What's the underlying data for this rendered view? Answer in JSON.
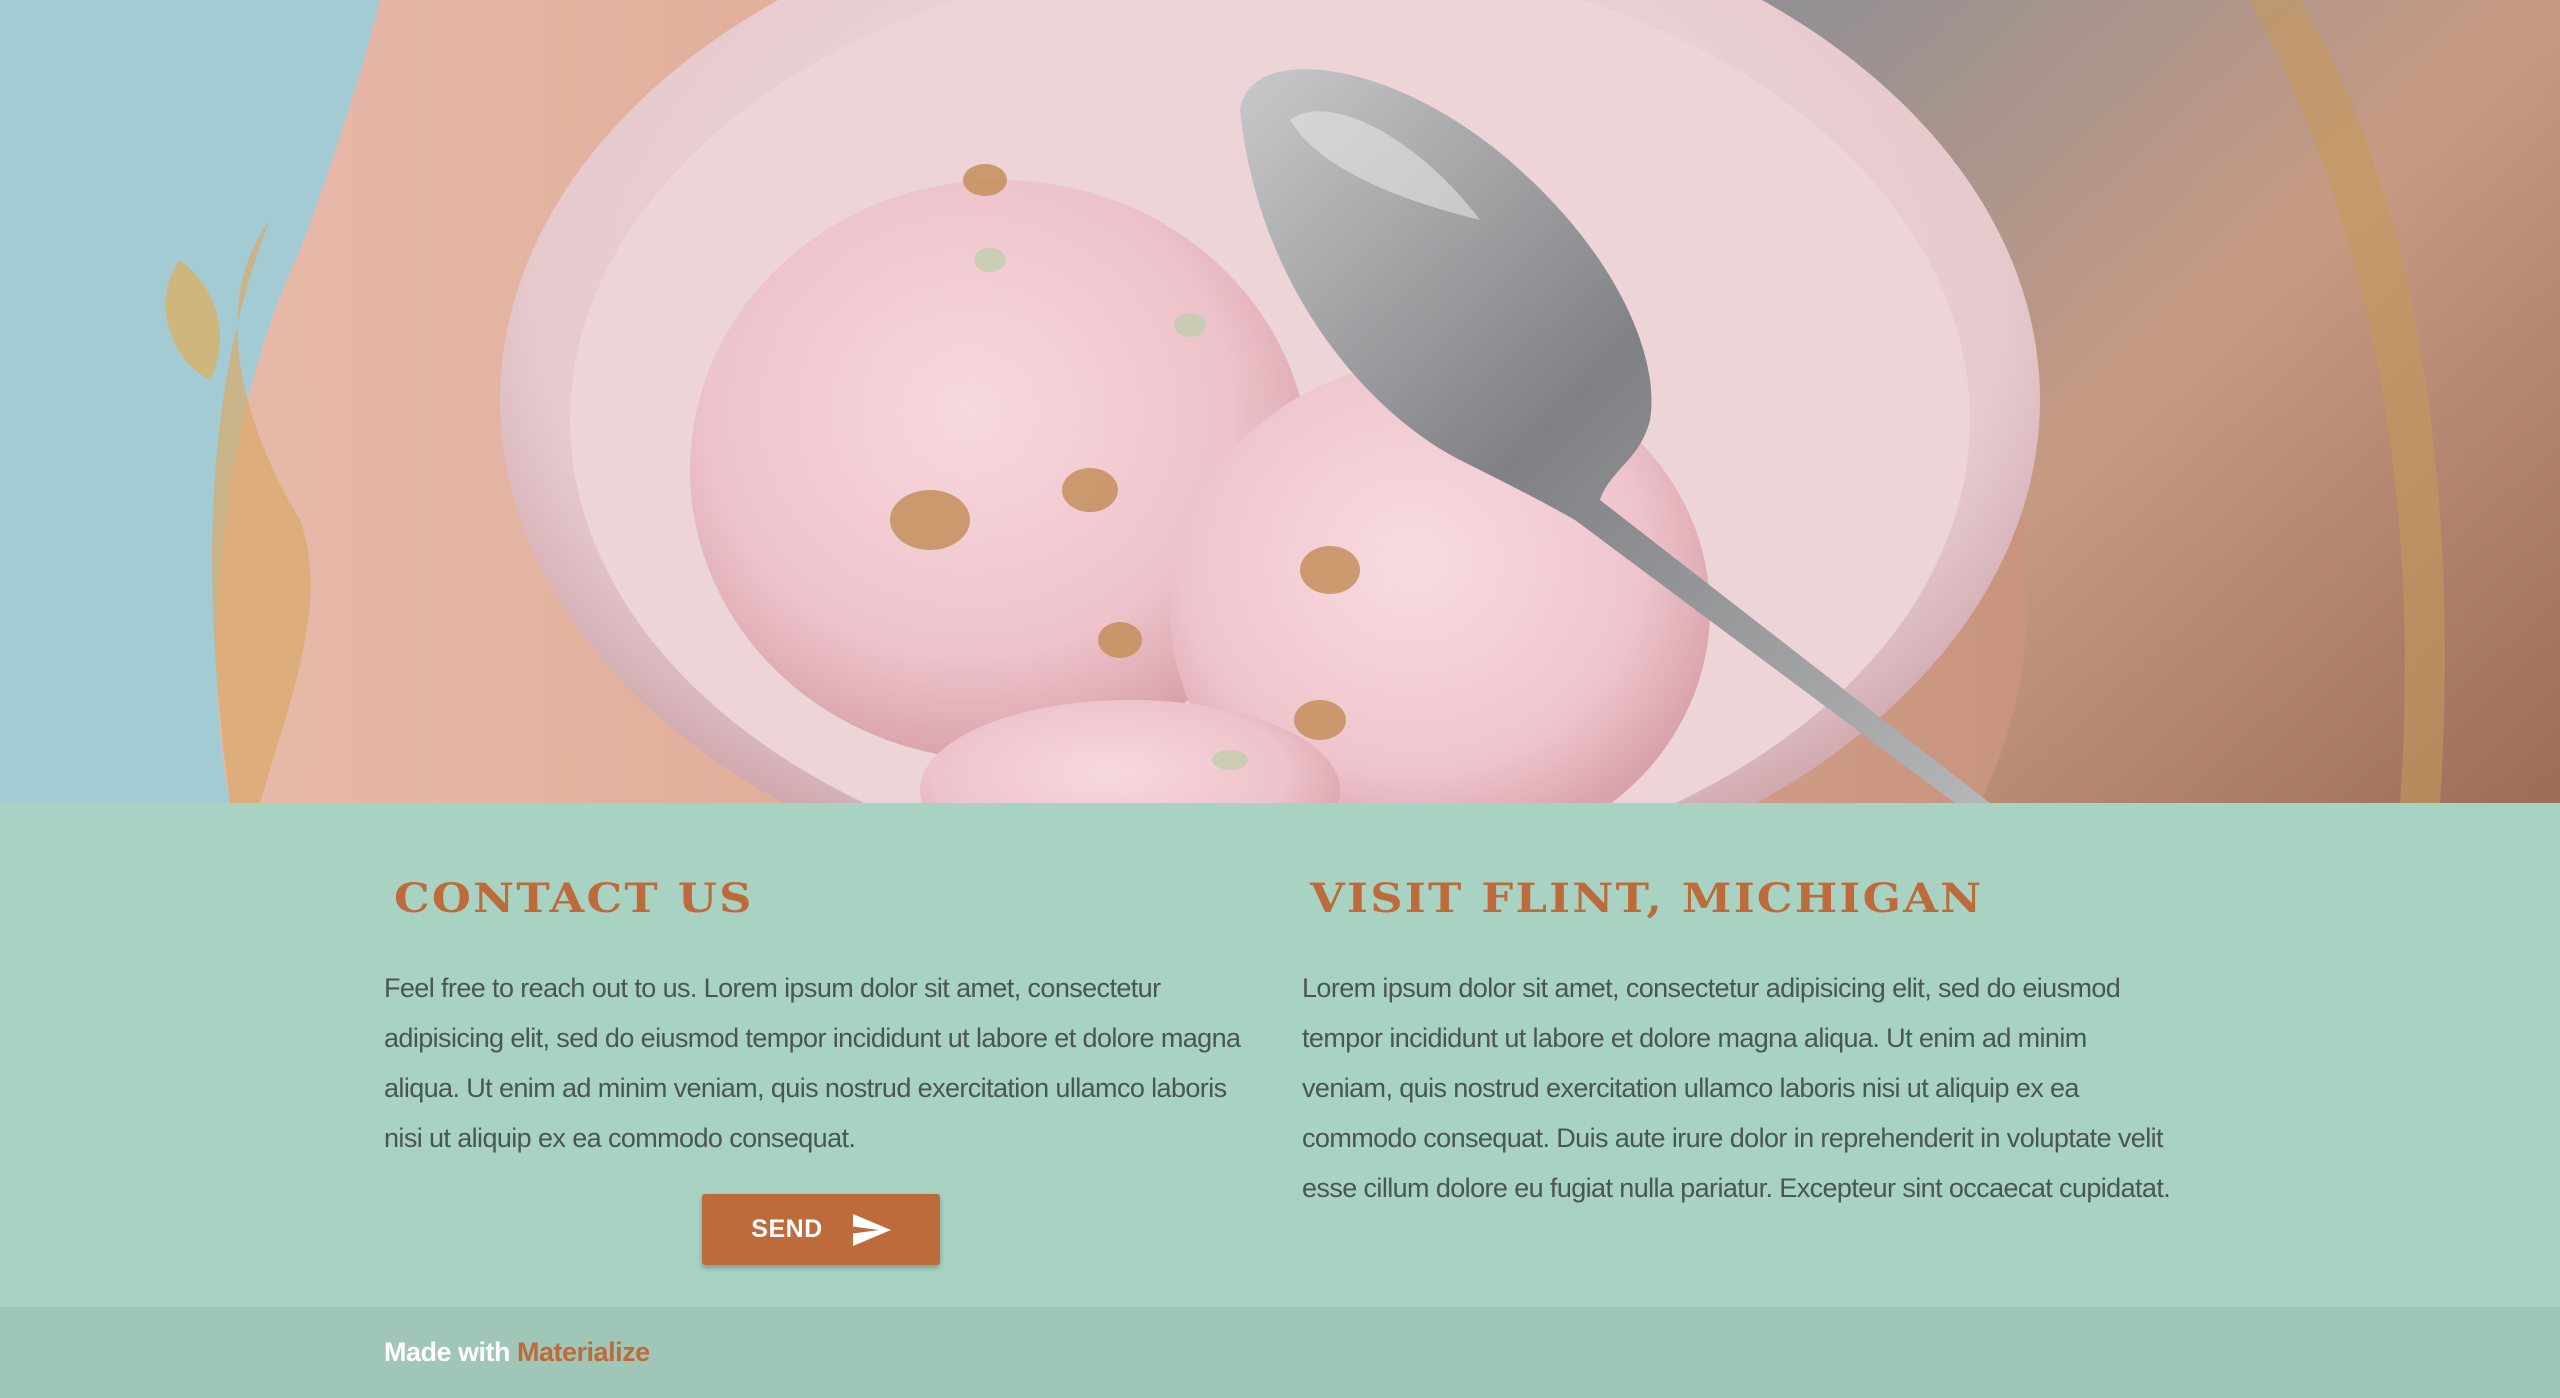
{
  "hero": {
    "image_subject": "ice-cream-bowl-photo"
  },
  "contact": {
    "title": "CONTACT US",
    "text": "Feel free to reach out to us. Lorem ipsum dolor sit amet, consectetur adipisicing elit, sed do eiusmod tempor incididunt ut labore et dolore magna aliqua. Ut enim ad minim veniam, quis nostrud exercitation ullamco laboris nisi ut aliquip ex ea commodo consequat.",
    "send_label": "SEND",
    "send_icon": "send-icon"
  },
  "visit": {
    "title": "VISIT FLINT, MICHIGAN",
    "text": "Lorem ipsum dolor sit amet, consectetur adipisicing elit, sed do eiusmod tempor incididunt ut labore et dolore magna aliqua. Ut enim ad minim veniam, quis nostrud exercitation ullamco laboris nisi ut aliquip ex ea commodo consequat. Duis aute irure dolor in reprehenderit in voluptate velit esse cillum dolore eu fugiat nulla pariatur. Excepteur sint occaecat cupidatat."
  },
  "footer": {
    "made_with": "Made with",
    "link_label": "Materialize"
  },
  "colors": {
    "accent": "#bd6b3a",
    "section_bg": "#a8d3c3",
    "footer_bg": "#a0c6b7",
    "body_text": "#4a5650"
  }
}
